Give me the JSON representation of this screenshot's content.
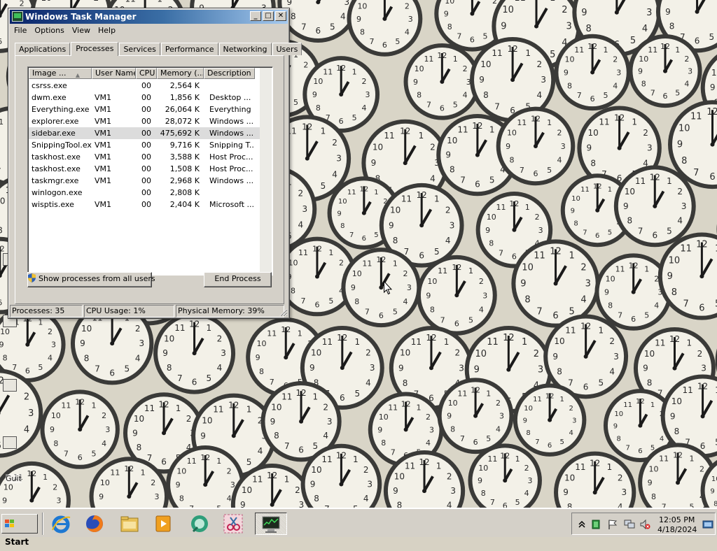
{
  "window": {
    "title": "Windows Task Manager",
    "min_glyph": "_",
    "max_glyph": "□",
    "close_glyph": "✕"
  },
  "menu": [
    "File",
    "Options",
    "View",
    "Help"
  ],
  "tabs": [
    "Applications",
    "Processes",
    "Services",
    "Performance",
    "Networking",
    "Users"
  ],
  "active_tab": "Processes",
  "columns": {
    "image": "Image ...",
    "user": "User Name",
    "cpu": "CPU",
    "memory": "Memory (...",
    "description": "Description"
  },
  "processes": [
    {
      "image": "csrss.exe",
      "user": "",
      "cpu": "00",
      "memory": "2,564 K",
      "description": ""
    },
    {
      "image": "dwm.exe",
      "user": "VM1",
      "cpu": "00",
      "memory": "1,856 K",
      "description": "Desktop ..."
    },
    {
      "image": "Everything.exe",
      "user": "VM1",
      "cpu": "00",
      "memory": "26,064 K",
      "description": "Everything"
    },
    {
      "image": "explorer.exe",
      "user": "VM1",
      "cpu": "00",
      "memory": "28,072 K",
      "description": "Windows ..."
    },
    {
      "image": "sidebar.exe",
      "user": "VM1",
      "cpu": "00",
      "memory": "475,692 K",
      "description": "Windows ..."
    },
    {
      "image": "SnippingTool.exe",
      "user": "VM1",
      "cpu": "00",
      "memory": "9,716 K",
      "description": "Snipping T..."
    },
    {
      "image": "taskhost.exe",
      "user": "VM1",
      "cpu": "00",
      "memory": "3,588 K",
      "description": "Host Proc..."
    },
    {
      "image": "taskhost.exe",
      "user": "VM1",
      "cpu": "00",
      "memory": "1,508 K",
      "description": "Host Proc..."
    },
    {
      "image": "taskmgr.exe",
      "user": "VM1",
      "cpu": "00",
      "memory": "2,968 K",
      "description": "Windows ..."
    },
    {
      "image": "winlogon.exe",
      "user": "",
      "cpu": "00",
      "memory": "2,808 K",
      "description": ""
    },
    {
      "image": "wisptis.exe",
      "user": "VM1",
      "cpu": "00",
      "memory": "2,404 K",
      "description": "Microsoft ..."
    }
  ],
  "selected_process": "sidebar.exe",
  "buttons": {
    "show_all": "Show processes from all users",
    "end_process": "End Process"
  },
  "status": {
    "processes": "Processes: 35",
    "cpu": "CPU Usage: 1%",
    "memory": "Physical Memory: 39%"
  },
  "desktop": {
    "wallpaper": "analog clock faces",
    "icon_label": "Guit"
  },
  "taskbar": {
    "start_label": "Start",
    "pinned": [
      "internet-explorer-icon",
      "firefox-icon",
      "explorer-folder-icon",
      "media-player-icon",
      "app-icon",
      "snipping-tool-icon",
      "task-manager-icon"
    ],
    "active_app": "task-manager-icon",
    "clock_time": "12:05 PM",
    "clock_date": "4/18/2024"
  },
  "colors": {
    "title_active": "#0a246a",
    "chrome": "#d4d0c8",
    "selection": "#dcdcdc"
  }
}
